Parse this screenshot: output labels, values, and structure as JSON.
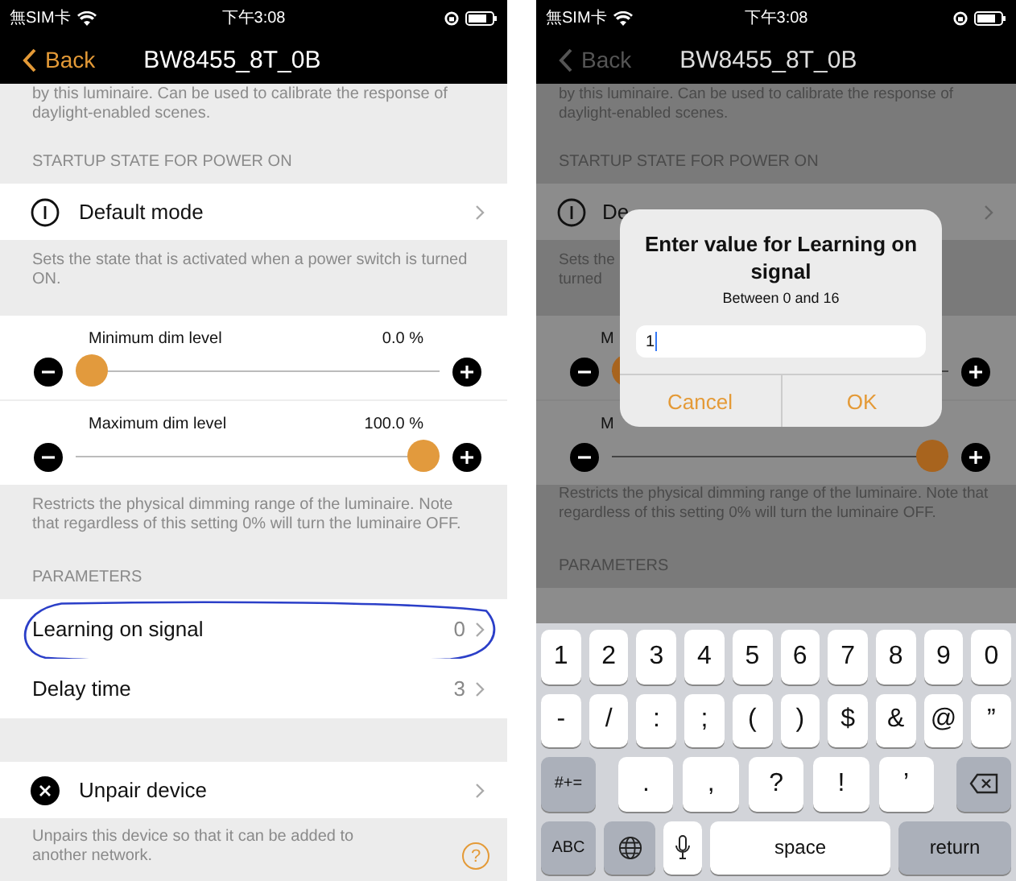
{
  "screens": [
    {
      "dimmed": false,
      "status_bar": {
        "carrier": "無SIM卡",
        "time": "下午3:08"
      },
      "nav": {
        "back": "Back",
        "title": "BW8455_8T_0B"
      },
      "top_note": "by this luminaire. Can be used to calibrate the response of daylight-enabled scenes.",
      "startup_header": "STARTUP STATE FOR POWER ON",
      "default_mode": {
        "label": "Default mode",
        "note": "Sets the state that is activated when a power switch is turned ON."
      },
      "sliders": [
        {
          "label": "Minimum dim level",
          "reading": "0.0 %",
          "level": 0
        },
        {
          "label": "Maximum dim level",
          "reading": "100.0 %",
          "level": 1
        }
      ],
      "sliders_note": "Restricts the physical dimming range of the luminaire. Note that regardless of this setting 0% will turn the luminaire OFF.",
      "parameters_header": "PARAMETERS",
      "parameters": [
        {
          "label": "Learning on signal",
          "value": "0",
          "circled": true
        },
        {
          "label": "Delay time",
          "value": "3",
          "circled": false
        }
      ],
      "unpair": {
        "label": "Unpair device",
        "note": "Unpairs this device so that it can be added to another network."
      },
      "help": "?"
    },
    {
      "dimmed": true,
      "status_bar": {
        "carrier": "無SIM卡",
        "time": "下午3:08"
      },
      "nav": {
        "back": "Back",
        "title": "BW8455_8T_0B"
      },
      "top_note": "by this luminaire. Can be used to calibrate the response of daylight-enabled scenes.",
      "startup_header": "STARTUP STATE FOR POWER ON",
      "default_mode": {
        "label": "De",
        "note_lines": [
          "Sets the",
          "turned"
        ]
      },
      "sliders": [
        {
          "label": "M",
          "level": 0
        },
        {
          "label": "M",
          "level": 1
        }
      ],
      "sliders_note": "Restricts the physical dimming range of the luminaire. Note that regardless of this setting 0% will turn the luminaire OFF.",
      "parameters_header": "PARAMETERS",
      "dialog": {
        "title": "Enter value for Learning on signal",
        "subtitle": "Between 0 and 16",
        "value": "1",
        "buttons": [
          "Cancel",
          "OK"
        ]
      },
      "keyboard": [
        [
          {
            "kind": "char",
            "label": "1"
          },
          {
            "kind": "char",
            "label": "2"
          },
          {
            "kind": "char",
            "label": "3"
          },
          {
            "kind": "char",
            "label": "4"
          },
          {
            "kind": "char",
            "label": "5"
          },
          {
            "kind": "char",
            "label": "6"
          },
          {
            "kind": "char",
            "label": "7"
          },
          {
            "kind": "char",
            "label": "8"
          },
          {
            "kind": "char",
            "label": "9"
          },
          {
            "kind": "char",
            "label": "0"
          }
        ],
        [
          {
            "kind": "char",
            "label": "-"
          },
          {
            "kind": "char",
            "label": "/"
          },
          {
            "kind": "char",
            "label": ":"
          },
          {
            "kind": "char",
            "label": ";"
          },
          {
            "kind": "char",
            "label": "("
          },
          {
            "kind": "char",
            "label": ")"
          },
          {
            "kind": "char",
            "label": "$"
          },
          {
            "kind": "char",
            "label": "&"
          },
          {
            "kind": "char",
            "label": "@"
          },
          {
            "kind": "char",
            "label": "”"
          }
        ],
        [
          {
            "kind": "function",
            "label": "#+="
          },
          {
            "kind": "wide",
            "label": "."
          },
          {
            "kind": "wide",
            "label": ","
          },
          {
            "kind": "wide",
            "label": "?"
          },
          {
            "kind": "wide",
            "label": "!"
          },
          {
            "kind": "wide",
            "label": "’"
          },
          {
            "kind": "delete"
          }
        ],
        [
          {
            "kind": "function",
            "label": "ABC"
          },
          {
            "kind": "globe"
          },
          {
            "kind": "mic"
          },
          {
            "kind": "space",
            "label": "space"
          },
          {
            "kind": "return",
            "label": "return"
          }
        ]
      ]
    }
  ]
}
